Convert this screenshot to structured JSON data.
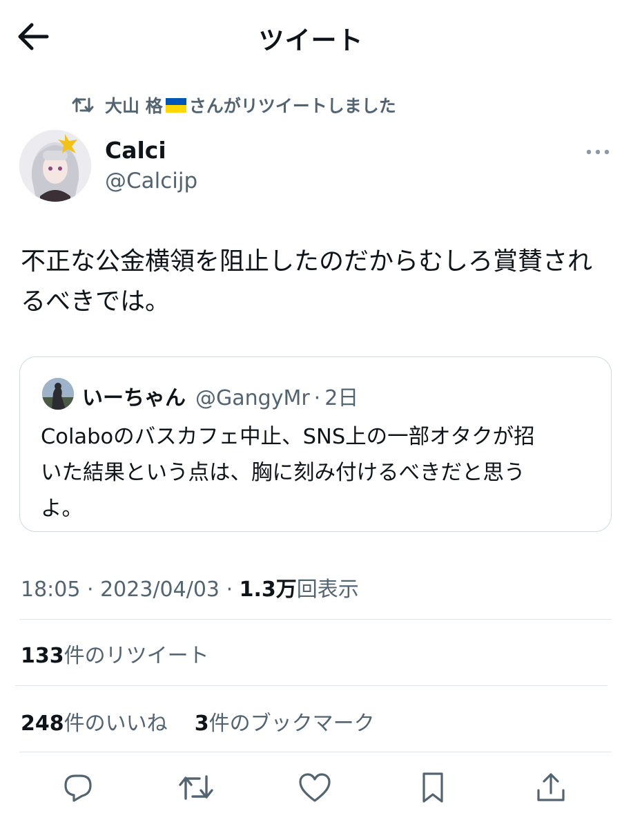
{
  "header": {
    "title": "ツイート",
    "back_icon": "arrow-left-icon"
  },
  "retweet_banner": {
    "retweeter_name": "大山 格",
    "suffix": "さんがリツイートしました",
    "icon": "retweet-icon"
  },
  "author": {
    "display_name": "Calci",
    "handle": "@Calcijp",
    "avatar_icon": "avatar-image"
  },
  "tweet": {
    "lines": [
      "不正な公金横領を阻止したのだからむしろ賞賛され",
      "るべきでは。"
    ]
  },
  "quoted_tweet": {
    "display_name": "いーちゃん",
    "handle": "@GangyMr",
    "time": "2日",
    "lines": [
      "Colaboのバスカフェ中止、SNS上の一部オタクが招",
      "いた結果という点は、胸に刻み付けるべきだと思う",
      "よ。"
    ]
  },
  "meta": {
    "time": "18:05",
    "date": "2023/04/03",
    "views_count": "1.3万",
    "views_label": "回表示"
  },
  "stats": {
    "retweets_count": "133",
    "retweets_label": "件のリツイート",
    "likes_count": "248",
    "likes_label": "件のいいね",
    "bookmarks_count": "3",
    "bookmarks_label": "件のブックマーク"
  },
  "actions": [
    "reply-icon",
    "retweet-icon",
    "like-icon",
    "bookmark-icon",
    "share-icon"
  ],
  "colors": {
    "text": "#0f1419",
    "secondary": "#536471",
    "border": "#cfd9de",
    "flag_blue": "#0057b7",
    "flag_yellow": "#ffd700"
  }
}
